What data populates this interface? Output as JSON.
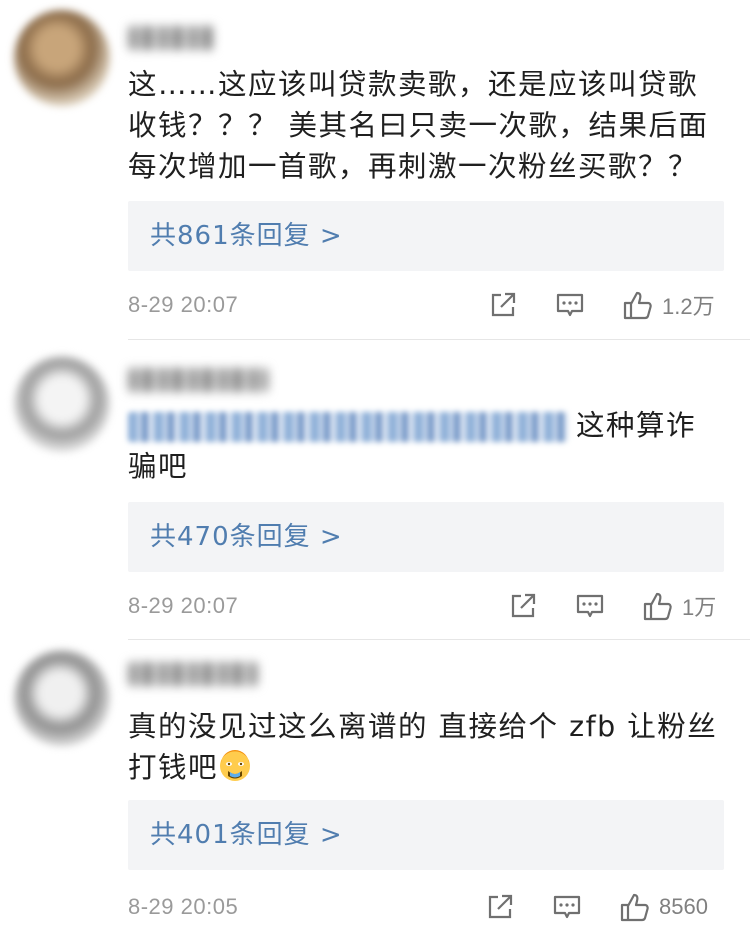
{
  "comments": [
    {
      "text_parts": [
        "这……这应该叫贷款卖歌，还是应该叫贷歌",
        "收钱？？？ 美其名曰只卖一次歌，结果后面",
        "每次增加一首歌，再刺激一次粉丝买歌？？"
      ],
      "reply_label": "共861条回复 >",
      "timestamp": "8-29 20:07",
      "likes": "1.2万"
    },
    {
      "text_tail_line1": "这种算诈",
      "text_line2": "骗吧",
      "reply_label": "共470条回复 >",
      "timestamp": "8-29 20:07",
      "likes": "1万"
    },
    {
      "text_line1": "真的没见过这么离谱的 直接给个 zfb 让粉丝",
      "text_line2": "打钱吧",
      "reply_label": "共401条回复 >",
      "timestamp": "8-29 20:05",
      "likes": "8560"
    }
  ],
  "icons": {
    "share": "share-icon",
    "comment": "comment-icon",
    "like": "thumbs-up-icon",
    "emoji": "hot-face-emoji"
  },
  "colors": {
    "reply_link": "#507daf",
    "meta_gray": "#9a9a9a",
    "reply_bg": "#f3f4f6"
  }
}
